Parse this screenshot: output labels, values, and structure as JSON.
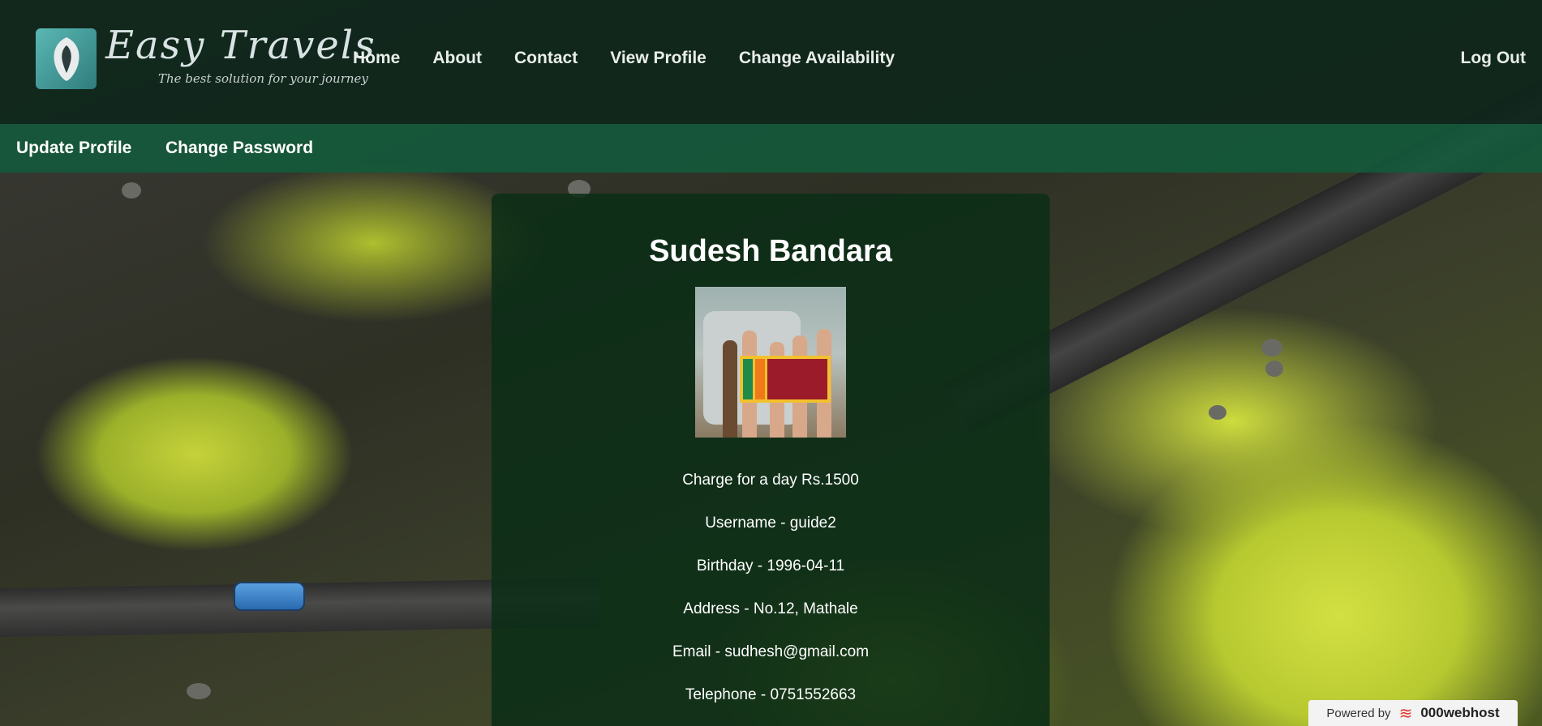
{
  "brand": {
    "name": "Easy Travels",
    "tagline": "The best solution for your journey"
  },
  "nav": {
    "items": [
      "Home",
      "About",
      "Contact",
      "View Profile",
      "Change Availability"
    ],
    "logout": "Log Out"
  },
  "subnav": {
    "update_profile": "Update Profile",
    "change_password": "Change Password"
  },
  "profile": {
    "name": "Sudesh Bandara",
    "charge": "Charge for a day  Rs.1500",
    "username": "Username - guide2",
    "birthday": "Birthday - 1996-04-11",
    "address": "Address - No.12, Mathale",
    "email": "Email - sudhesh@gmail.com",
    "telephone": "Telephone - 0751552663"
  },
  "footer_badge": {
    "powered_by": "Powered by",
    "host": "000webhost"
  }
}
